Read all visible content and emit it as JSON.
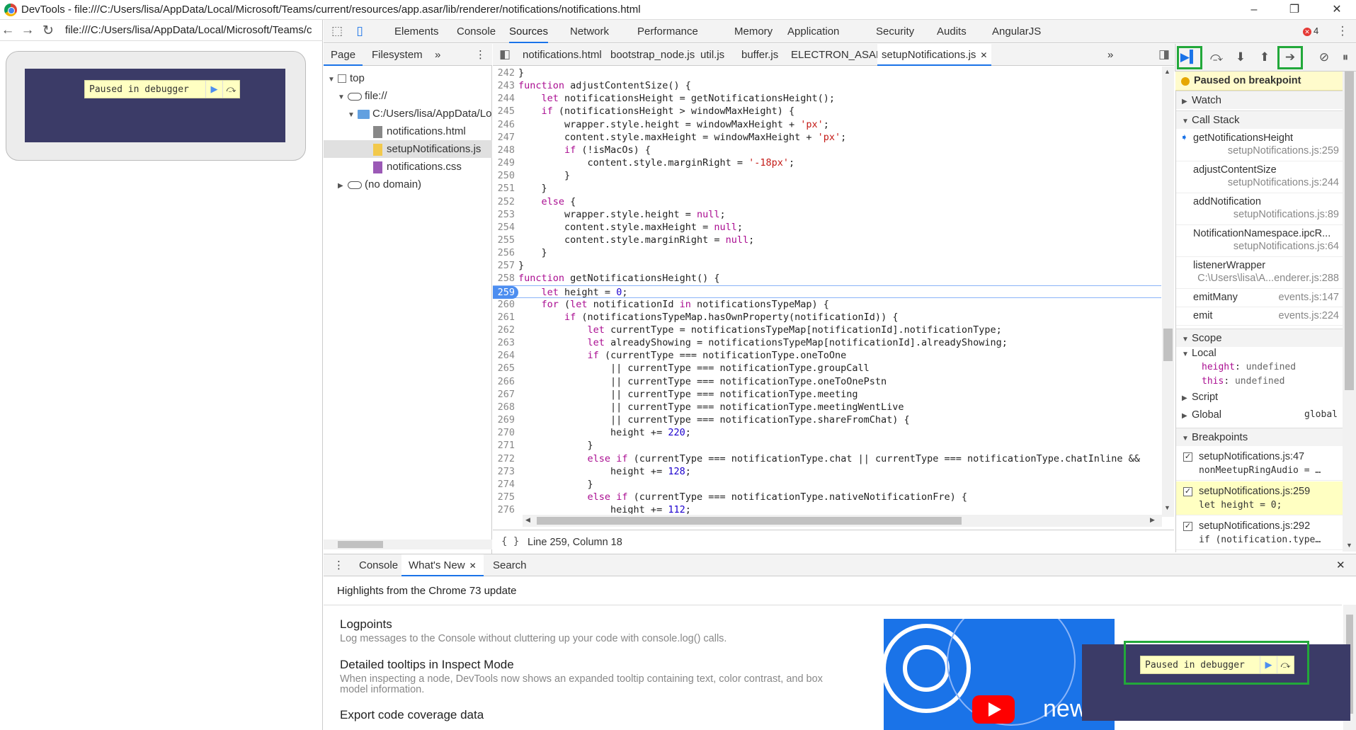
{
  "window": {
    "title": "DevTools - file:///C:/Users/lisa/AppData/Local/Microsoft/Teams/current/resources/app.asar/lib/renderer/notifications/notifications.html",
    "minimize": "–",
    "maximize": "❐",
    "close": "✕"
  },
  "browser": {
    "back": "←",
    "forward": "→",
    "reload": "↻",
    "url": "file:///C:/Users/lisa/AppData/Local/Microsoft/Teams/c",
    "paused_label": "Paused in debugger"
  },
  "devtools": {
    "tabs": [
      "Elements",
      "Console",
      "Sources",
      "Network",
      "Performance",
      "Memory",
      "Application",
      "Security",
      "Audits",
      "AngularJS"
    ],
    "active_tab": "Sources",
    "error_count": "4",
    "error_icon": "✕",
    "menu_icon": "⋮",
    "close_icon": "✕"
  },
  "navigator": {
    "tabs": [
      "Page",
      "Filesystem"
    ],
    "more": "»",
    "menu": "⋮",
    "tree": [
      {
        "label": "top",
        "level": 0,
        "kind": "frame",
        "expanded": true
      },
      {
        "label": "file://",
        "level": 1,
        "kind": "cloud",
        "expanded": true
      },
      {
        "label": "C:/Users/lisa/AppData/Lo",
        "level": 2,
        "kind": "folder",
        "expanded": true
      },
      {
        "label": "notifications.html",
        "level": 3,
        "kind": "html"
      },
      {
        "label": "setupNotifications.js",
        "level": 3,
        "kind": "js",
        "selected": true
      },
      {
        "label": "notifications.css",
        "level": 3,
        "kind": "css"
      },
      {
        "label": "(no domain)",
        "level": 1,
        "kind": "cloud",
        "expanded": false
      }
    ]
  },
  "editor": {
    "tabs": [
      "notifications.html",
      "bootstrap_node.js",
      "util.js",
      "buffer.js",
      "ELECTRON_ASAR.js",
      "setupNotifications.js"
    ],
    "active_tab": "setupNotifications.js",
    "tab_close": "✕",
    "more": "»",
    "status": "Line 259, Column 18",
    "pretty_print": "{ }",
    "current_line": "259",
    "lines": [
      {
        "n": "242",
        "t": "}"
      },
      {
        "n": "243",
        "t": "function adjustContentSize() {"
      },
      {
        "n": "244",
        "t": "    let notificationsHeight = getNotificationsHeight();"
      },
      {
        "n": "245",
        "t": "    if (notificationsHeight > windowMaxHeight) {"
      },
      {
        "n": "246",
        "t": "        wrapper.style.height = windowMaxHeight + 'px';"
      },
      {
        "n": "247",
        "t": "        content.style.maxHeight = windowMaxHeight + 'px';"
      },
      {
        "n": "248",
        "t": "        if (!isMacOs) {"
      },
      {
        "n": "249",
        "t": "            content.style.marginRight = '-18px';"
      },
      {
        "n": "250",
        "t": "        }"
      },
      {
        "n": "251",
        "t": "    }"
      },
      {
        "n": "252",
        "t": "    else {"
      },
      {
        "n": "253",
        "t": "        wrapper.style.height = null;"
      },
      {
        "n": "254",
        "t": "        content.style.maxHeight = null;"
      },
      {
        "n": "255",
        "t": "        content.style.marginRight = null;"
      },
      {
        "n": "256",
        "t": "    }"
      },
      {
        "n": "257",
        "t": "}"
      },
      {
        "n": "258",
        "t": "function getNotificationsHeight() {"
      },
      {
        "n": "259",
        "t": "    let height = 0;"
      },
      {
        "n": "260",
        "t": "    for (let notificationId in notificationsTypeMap) {"
      },
      {
        "n": "261",
        "t": "        if (notificationsTypeMap.hasOwnProperty(notificationId)) {"
      },
      {
        "n": "262",
        "t": "            let currentType = notificationsTypeMap[notificationId].notificationType;"
      },
      {
        "n": "263",
        "t": "            let alreadyShowing = notificationsTypeMap[notificationId].alreadyShowing;"
      },
      {
        "n": "264",
        "t": "            if (currentType === notificationType.oneToOne"
      },
      {
        "n": "265",
        "t": "                || currentType === notificationType.groupCall"
      },
      {
        "n": "266",
        "t": "                || currentType === notificationType.oneToOnePstn"
      },
      {
        "n": "267",
        "t": "                || currentType === notificationType.meeting"
      },
      {
        "n": "268",
        "t": "                || currentType === notificationType.meetingWentLive"
      },
      {
        "n": "269",
        "t": "                || currentType === notificationType.shareFromChat) {"
      },
      {
        "n": "270",
        "t": "                height += 220;"
      },
      {
        "n": "271",
        "t": "            }"
      },
      {
        "n": "272",
        "t": "            else if (currentType === notificationType.chat || currentType === notificationType.chatInline &&"
      },
      {
        "n": "273",
        "t": "                height += 128;"
      },
      {
        "n": "274",
        "t": "            }"
      },
      {
        "n": "275",
        "t": "            else if (currentType === notificationType.nativeNotificationFre) {"
      },
      {
        "n": "276",
        "t": "                height += 112;"
      },
      {
        "n": "277",
        "t": ""
      }
    ]
  },
  "debugger": {
    "buttons": [
      "resume",
      "step-over",
      "step-into",
      "step-out",
      "step",
      "deactivate-breakpoints",
      "pause-on-exceptions"
    ],
    "paused_banner": "Paused on breakpoint",
    "sections": {
      "watch": "Watch",
      "call_stack": "Call Stack",
      "scope": "Scope",
      "breakpoints": "Breakpoints"
    },
    "call_stack": [
      {
        "fn": "getNotificationsHeight",
        "loc": "setupNotifications.js:259",
        "current": true
      },
      {
        "fn": "adjustContentSize",
        "loc": "setupNotifications.js:244"
      },
      {
        "fn": "addNotification",
        "loc": "setupNotifications.js:89"
      },
      {
        "fn": "NotificationNamespace.ipcR...",
        "loc": "setupNotifications.js:64"
      },
      {
        "fn": "listenerWrapper",
        "loc": "C:\\Users\\lisa\\A...enderer.js:288"
      },
      {
        "fn": "emitMany",
        "loc": "events.js:147",
        "inline": true
      },
      {
        "fn": "emit",
        "loc": "events.js:224",
        "inline": true
      }
    ],
    "scope": {
      "local_label": "Local",
      "vars": [
        {
          "name": "height",
          "value": "undefined"
        },
        {
          "name": "this",
          "value": "undefined"
        }
      ],
      "script_label": "Script",
      "global_label": "Global",
      "global_value": "global"
    },
    "breakpoints": [
      {
        "loc": "setupNotifications.js:47",
        "code": "nonMeetupRingAudio = …",
        "checked": true
      },
      {
        "loc": "setupNotifications.js:259",
        "code": "let height = 0;",
        "checked": true,
        "active": true
      },
      {
        "loc": "setupNotifications.js:292",
        "code": "if (notification.type…",
        "checked": true
      }
    ]
  },
  "drawer": {
    "tabs": [
      "Console",
      "What's New",
      "Search"
    ],
    "active_tab": "What's New",
    "tab_close": "✕",
    "menu": "⋮",
    "close": "✕",
    "headline": "Highlights from the Chrome 73 update",
    "items": [
      {
        "title": "Logpoints",
        "desc": "Log messages to the Console without cluttering up your code with console.log() calls."
      },
      {
        "title": "Detailed tooltips in Inspect Mode",
        "desc": "When inspecting a node, DevTools now shows an expanded tooltip containing text, color contrast, and box model information."
      },
      {
        "title": "Export code coverage data",
        "desc": ""
      }
    ],
    "banner_text": "new",
    "overlay_label": "Paused in debugger"
  },
  "colors": {
    "accent": "#1a73e8",
    "highlight_box": "#22a83a",
    "preview_dark": "#3b3b67",
    "paused_bg": "#ffffc2"
  }
}
